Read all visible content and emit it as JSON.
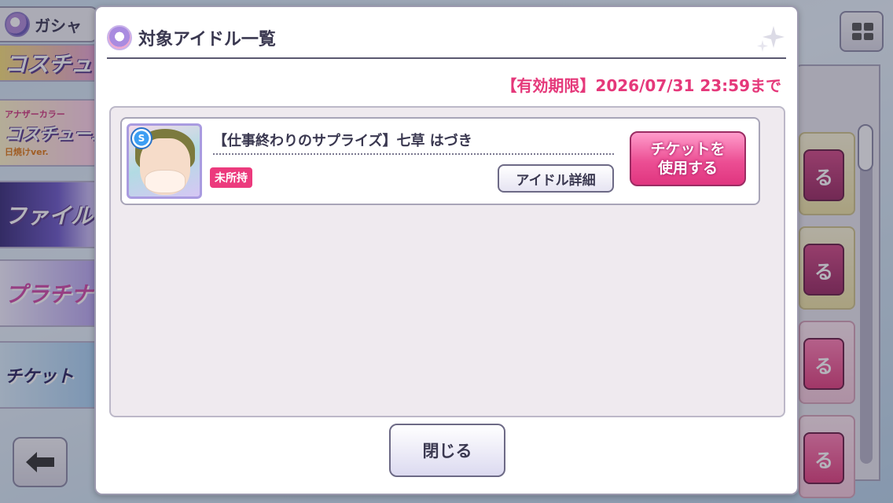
{
  "background": {
    "gacha_tab": {
      "label": "ガシャ"
    },
    "banners": [
      {
        "label": "コスチューム"
      },
      {
        "label": "コスチューム",
        "sub_top": "アナザーカラー",
        "sub_bottom": "日焼けver."
      },
      {
        "label": "ファイル"
      },
      {
        "label": "プラチナ"
      },
      {
        "label": "チケット"
      }
    ],
    "right_cards": [
      {
        "button_label": "る"
      },
      {
        "button_label": "る"
      },
      {
        "button_label": "る"
      },
      {
        "button_label": "る"
      }
    ]
  },
  "dialog": {
    "title": "対象アイドル一覧",
    "deadline": "【有効期限】2026/07/31 23:59まで",
    "idols": [
      {
        "name": "【仕事終わりのサプライズ】七草 はづき",
        "rarity": "S",
        "status": "未所持",
        "detail_label": "アイドル詳細",
        "use_ticket_line1": "チケットを",
        "use_ticket_line2": "使用する"
      }
    ],
    "close_label": "閉じる"
  },
  "colors": {
    "accent_pink": "#e5387a",
    "badge_pink": "#ec3a7d",
    "title_text": "#3a3850"
  },
  "icons": {
    "header": "gacha-emblem-icon",
    "sparkle": "sparkle-icon",
    "back": "back-arrow-icon",
    "menu": "grid-menu-icon"
  }
}
